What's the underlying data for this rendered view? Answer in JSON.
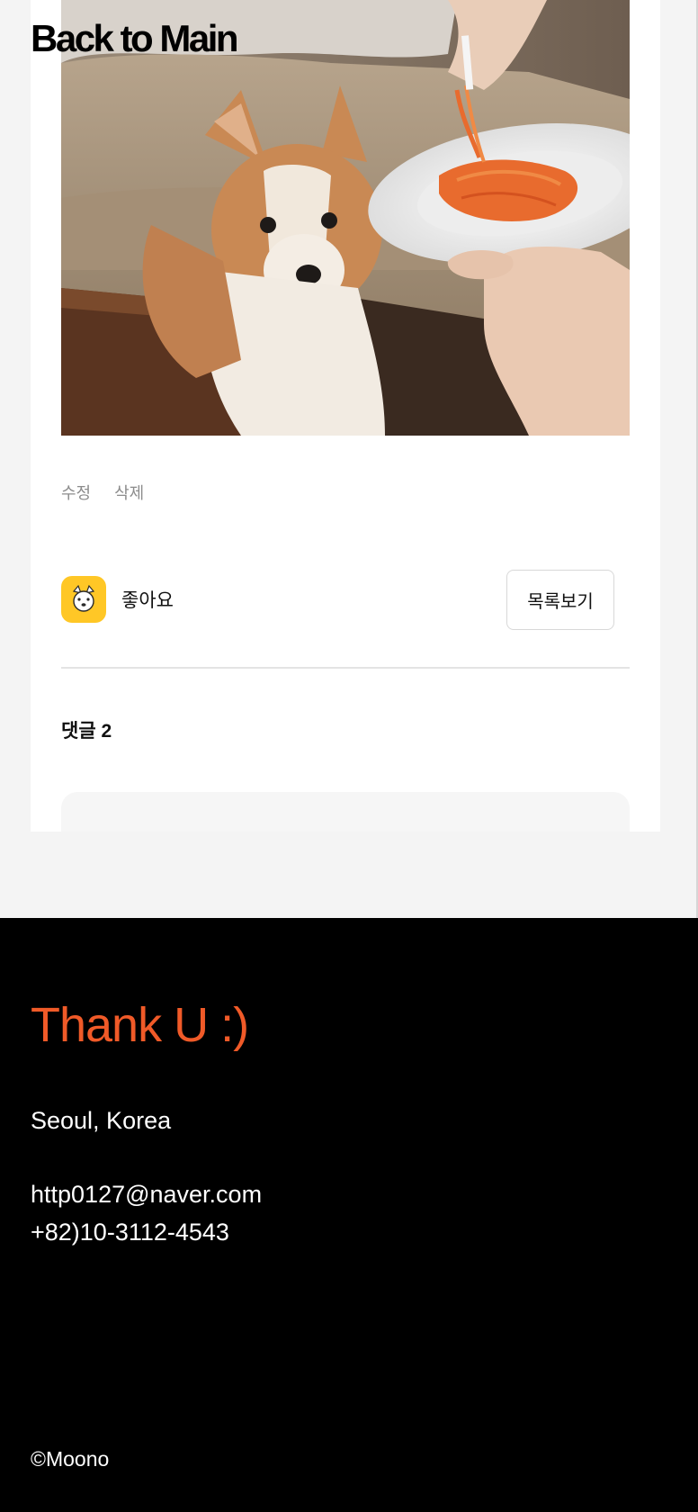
{
  "header": {
    "back_to_main": "Back to Main"
  },
  "post": {
    "photo_icon": "corgi-pasta-photo",
    "actions": {
      "edit": "수정",
      "delete": "삭제"
    },
    "like": {
      "icon": "corgi-face-icon",
      "label": "좋아요",
      "icon_color": "#ffc726"
    },
    "list_button": "목록보기",
    "comments": {
      "title": "댓글 2"
    }
  },
  "footer": {
    "thank": "Thank U :)",
    "city": "Seoul, Korea",
    "email": "http0127@naver.com",
    "phone": "+82)10-3112-4543",
    "copyright": "©Moono",
    "accent_color": "#f05a28"
  }
}
